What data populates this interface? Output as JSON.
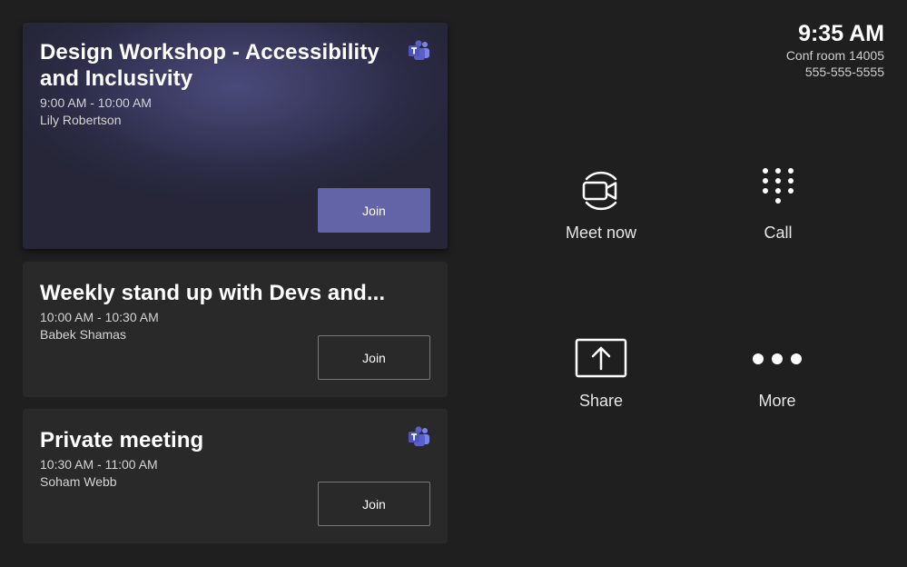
{
  "clock": {
    "time": "9:35 AM",
    "room": "Conf room 14005",
    "phone": "555-555-5555"
  },
  "meetings": [
    {
      "title": "Design Workshop - Accessibility and Inclusivity",
      "time": "9:00 AM - 10:00 AM",
      "organizer": "Lily Robertson",
      "join_label": "Join",
      "teams_icon": "teams-icon"
    },
    {
      "title": "Weekly stand up with Devs and...",
      "time": "10:00 AM - 10:30 AM",
      "organizer": "Babek Shamas",
      "join_label": "Join"
    },
    {
      "title": "Private meeting",
      "time": "10:30 AM - 11:00 AM",
      "organizer": "Soham Webb",
      "join_label": "Join",
      "teams_icon": "teams-icon"
    }
  ],
  "actions": {
    "meet_now": {
      "label": "Meet now",
      "icon": "video-camera-icon"
    },
    "call": {
      "label": "Call",
      "icon": "dialpad-icon"
    },
    "share": {
      "label": "Share",
      "icon": "share-screen-icon"
    },
    "more": {
      "label": "More",
      "icon": "more-dots-icon"
    }
  },
  "colors": {
    "background": "#1f1f1f",
    "card": "#292929",
    "accent": "#6264a7",
    "teams_purple": "#5b5fc7"
  }
}
